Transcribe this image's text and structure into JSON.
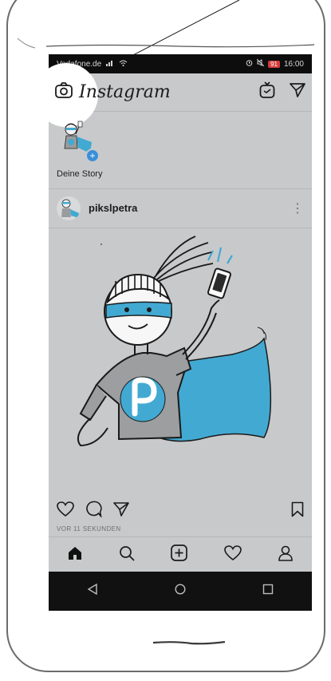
{
  "status": {
    "carrier": "Vodafone.de",
    "battery": "91",
    "time": "16:00"
  },
  "header": {
    "brand": "Instagram"
  },
  "stories": {
    "label": "Deine Story"
  },
  "post": {
    "username": "pikslpetra",
    "timestamp": "VOR 11 SEKUNDEN"
  },
  "colors": {
    "screen_bg": "#c8c9cb",
    "mask_blue": "#42a9d2",
    "badge_red": "#d23b3b",
    "add_blue": "#3a8fd9"
  },
  "icons": {
    "camera": "camera-icon",
    "igtv": "igtv-icon",
    "direct": "paper-plane-icon",
    "like": "heart-icon",
    "comment": "comment-icon",
    "share": "send-icon",
    "save": "bookmark-icon",
    "home": "home-icon",
    "search": "search-icon",
    "new_post": "plus-square-icon",
    "activity": "heart-icon",
    "profile": "profile-icon",
    "back": "back-triangle-icon",
    "android_home": "circle-home-icon",
    "recents": "square-recents-icon"
  }
}
